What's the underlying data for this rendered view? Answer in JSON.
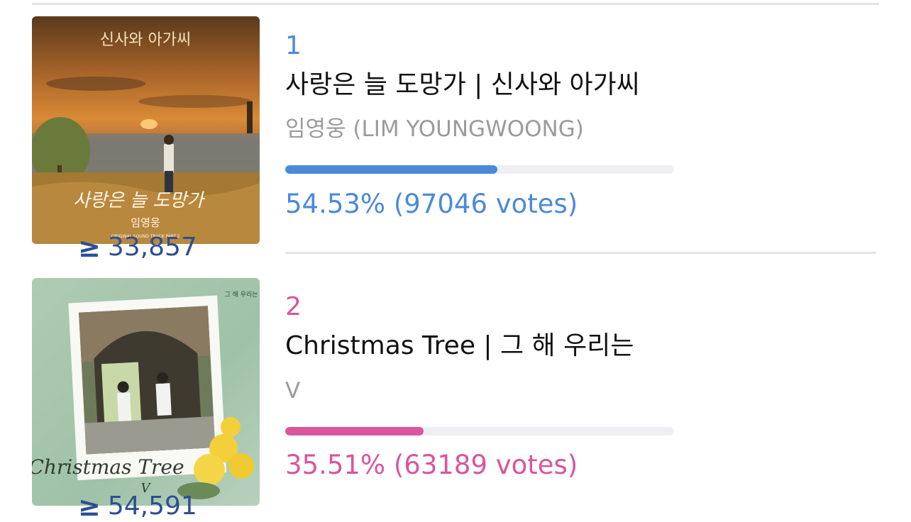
{
  "poll": {
    "entries": [
      {
        "rank": "1",
        "title": "사랑은 늘 도망가 | 신사와 아가씨",
        "artist": "임영웅 (LIM YOUNGWOONG)",
        "result": "54.53% (97046 votes)",
        "vote_share": 0.5453,
        "accent_color": "#4a8ad8",
        "album_art": {
          "header_text": "신사와 아가씨",
          "script_text": "사랑은 늘 도망가",
          "artist_text": "임영웅",
          "footer_text": "ORIGINAL SOUND TRACK PART.2"
        },
        "stream_icon": "greater-equal-icon",
        "stream_count": "33,857"
      },
      {
        "rank": "2",
        "title": "Christmas Tree | 그 해 우리는",
        "artist": "V",
        "result": "35.51% (63189 votes)",
        "vote_share": 0.3551,
        "accent_color": "#d9559c",
        "album_art": {
          "header_text": "그 해 우리는",
          "script_text": "Christmas Tree",
          "artist_text": "V"
        },
        "stream_icon": "greater-equal-icon",
        "stream_count": "54,591"
      }
    ]
  }
}
